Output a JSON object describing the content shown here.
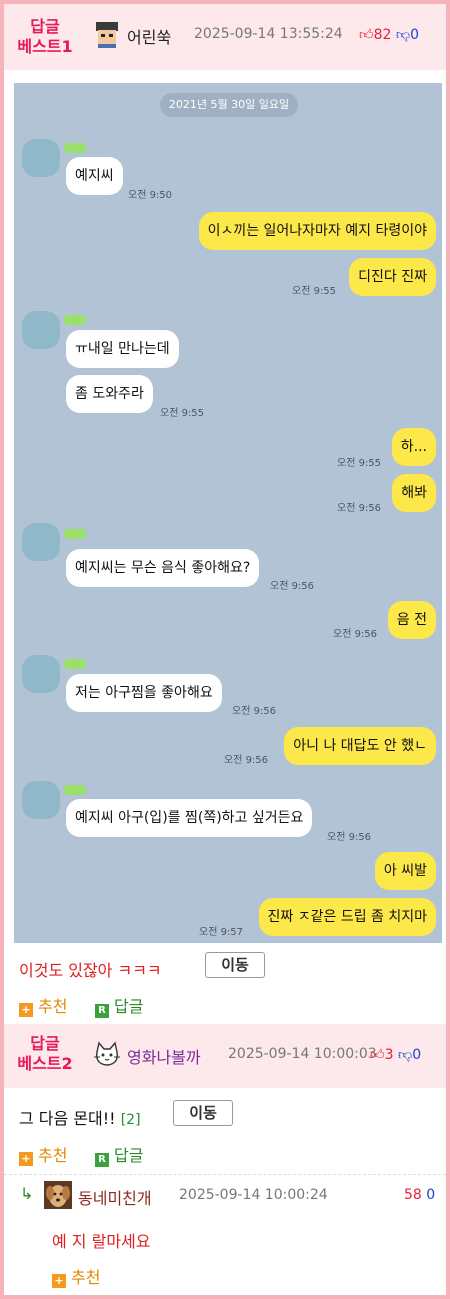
{
  "post1": {
    "badge_line1": "답글",
    "badge_line2": "베스트1",
    "nickname": "어린쑥",
    "date": "2025-09-14 13:55:24",
    "upvotes": "82",
    "downvotes": "0",
    "chat": {
      "date_label": "2021년 5월 30일 일요일",
      "messages": [
        {
          "side": "left",
          "text": "예지씨",
          "time": "오전 9:50"
        },
        {
          "side": "right",
          "text": "이ㅅ끼는 일어나자마자 예지 타령이야",
          "time": ""
        },
        {
          "side": "right",
          "text": "디진다 진짜",
          "time": "오전 9:55"
        },
        {
          "side": "left",
          "text": "ㅠ내일 만나는데",
          "time": ""
        },
        {
          "side": "left",
          "text": "좀 도와주라",
          "time": "오전 9:55"
        },
        {
          "side": "right",
          "text": "하...",
          "time": "오전 9:55"
        },
        {
          "side": "right",
          "text": "해봐",
          "time": "오전 9:56"
        },
        {
          "side": "left",
          "text": "예지씨는 무슨 음식 좋아해요?",
          "time": "오전 9:56"
        },
        {
          "side": "right",
          "text": "음 전",
          "time": "오전 9:56"
        },
        {
          "side": "left",
          "text": "저는 아구찜을 좋아해요",
          "time": "오전 9:56"
        },
        {
          "side": "right",
          "text": "아니 나 대답도 안 했ㄴ",
          "time": "오전 9:56"
        },
        {
          "side": "left",
          "text": "예지씨 아구(입)를 찜(쪽)하고 싶거든요",
          "time": "오전 9:56"
        },
        {
          "side": "right",
          "text": "아 씨발",
          "time": ""
        },
        {
          "side": "right",
          "text": "진짜 ㅈ같은 드립 좀 치지마",
          "time": "오전 9:57"
        }
      ]
    },
    "caption": "이것도 있잖아 ㅋㅋㅋ",
    "move_label": "이동",
    "recommend_label": "추천",
    "reply_label": "답글"
  },
  "post2": {
    "badge_line1": "답글",
    "badge_line2": "베스트2",
    "nickname": "영화나볼까",
    "date": "2025-09-14 10:00:03",
    "upvotes": "3",
    "downvotes": "0",
    "body": "그 다음 몬대!!",
    "reply_count": "[2]",
    "move_label": "이동",
    "recommend_label": "추천",
    "reply_label": "답글"
  },
  "reply": {
    "nickname": "동네미친개",
    "date": "2025-09-14 10:00:24",
    "upvotes": "58",
    "downvotes": "0",
    "body": "예 지 랄마세요",
    "recommend_label": "추천"
  },
  "colors": {
    "badge": "#e8195a",
    "header_bg": "#fde9ec",
    "frame": "#f7b3ba",
    "chat_bg": "#b2c3d6",
    "yellow_bubble": "#fde84a"
  }
}
